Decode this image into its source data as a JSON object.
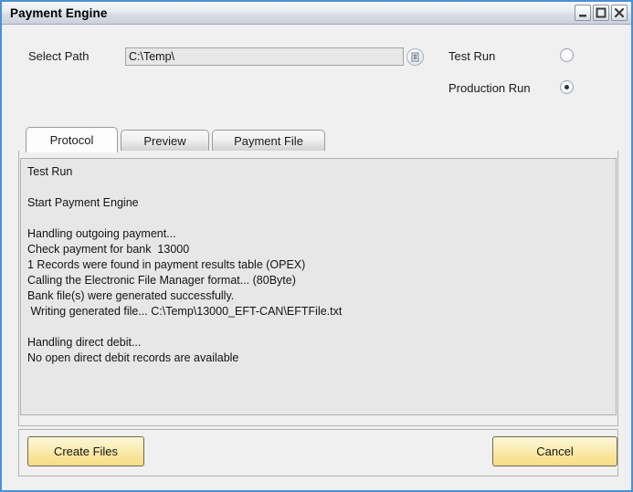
{
  "window": {
    "title": "Payment Engine",
    "controls": [
      {
        "name": "minimize",
        "label": "Minimize"
      },
      {
        "name": "maximize",
        "label": "Maximize"
      },
      {
        "name": "close",
        "label": "Close"
      }
    ],
    "border_color": "#4a90d9"
  },
  "form": {
    "select_path_label": "Select Path",
    "path_value": "C:\\Temp\\",
    "path_placeholder": "",
    "browse_icon": "list-lines-icon",
    "run_mode": {
      "options": [
        {
          "label": "Test Run",
          "selected": false
        },
        {
          "label": "Production Run",
          "selected": true
        }
      ]
    }
  },
  "tabs": [
    {
      "label": "Protocol",
      "active": true
    },
    {
      "label": "Preview",
      "active": false
    },
    {
      "label": "Payment File",
      "active": false
    }
  ],
  "log": {
    "lines": [
      "Test Run",
      "",
      "Start Payment Engine",
      "",
      "Handling outgoing payment...",
      "Check payment for bank  13000",
      "1 Records were found in payment results table (OPEX)",
      "Calling the Electronic File Manager format... (80Byte)",
      "Bank file(s) were generated successfully.",
      " Writing generated file... C:\\Temp\\13000_EFT-CAN\\EFTFile.txt",
      "",
      "Handling direct debit...",
      "No open direct debit records are available"
    ]
  },
  "actions": {
    "create_files_label": "Create Files",
    "cancel_label": "Cancel",
    "button_color": "#fae396"
  }
}
